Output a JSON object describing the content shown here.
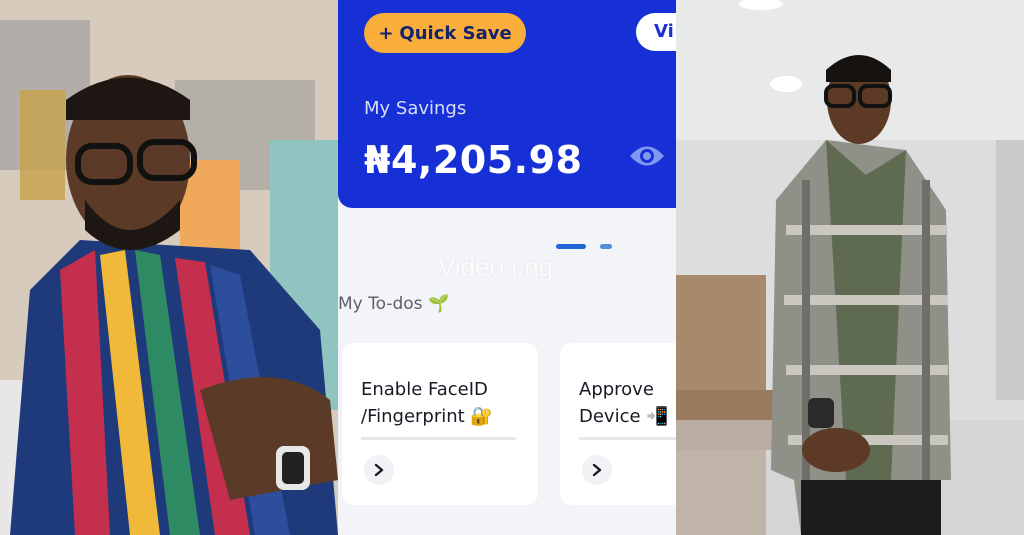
{
  "quick_save": {
    "icon": "+",
    "label": "Quick Save"
  },
  "view_button": {
    "label": "Vi"
  },
  "savings": {
    "label": "My Savings",
    "amount": "₦4,205.98"
  },
  "watermark": "Video.i.ng",
  "todos": {
    "title": "My To-dos",
    "title_emoji": "🌱",
    "items": [
      {
        "line1": "Enable FaceID",
        "line2": "/Fingerprint 🔐"
      },
      {
        "line1": "Approve",
        "line2": "Device 📲"
      }
    ]
  },
  "colors": {
    "brand_blue": "#1630d6",
    "accent_orange": "#f9ad3b",
    "page_bg": "#f3f4f8"
  },
  "icons": [
    "plus-icon",
    "eye-icon",
    "seedling-icon",
    "lock-icon",
    "phone-icon",
    "chevron-right-icon"
  ]
}
